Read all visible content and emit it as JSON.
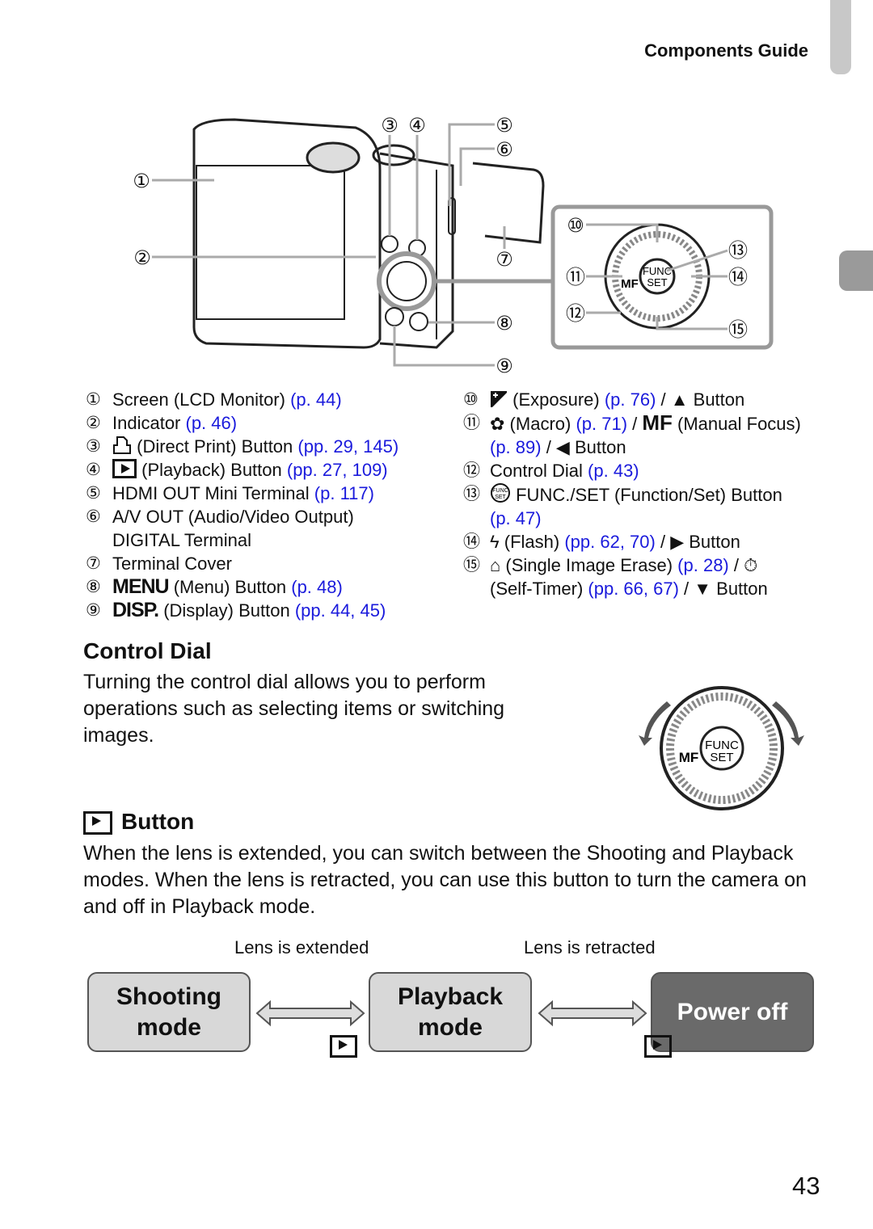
{
  "header": {
    "title": "Components Guide"
  },
  "diagram": {
    "callouts": [
      "①",
      "②",
      "③",
      "④",
      "⑤",
      "⑥",
      "⑦",
      "⑧",
      "⑨",
      "⑩",
      "⑪",
      "⑫",
      "⑬",
      "⑭",
      "⑮"
    ],
    "dial_labels": {
      "func": "FUNC",
      "set": "SET",
      "mf": "MF"
    }
  },
  "components_left": [
    {
      "num": "①",
      "text": "Screen (LCD Monitor) ",
      "ref": "(p. 44)"
    },
    {
      "num": "②",
      "text": "Indicator ",
      "ref": "(p. 46)"
    },
    {
      "num": "③",
      "icon": "print-icon",
      "text": " (Direct Print) Button ",
      "ref": "(pp. 29, 145)"
    },
    {
      "num": "④",
      "icon": "playback-icon",
      "text": " (Playback) Button ",
      "ref": "(pp. 27, 109)"
    },
    {
      "num": "⑤",
      "text": "HDMI OUT Mini Terminal ",
      "ref": "(p. 117)"
    },
    {
      "num": "⑥",
      "text": "A/V OUT (Audio/Video Output)",
      "cont": "DIGITAL Terminal"
    },
    {
      "num": "⑦",
      "text": "Terminal Cover"
    },
    {
      "num": "⑧",
      "iconText": "MENU",
      "text": " (Menu) Button ",
      "ref": "(p. 48)"
    },
    {
      "num": "⑨",
      "iconText": "DISP.",
      "text": " (Display) Button ",
      "ref": "(pp. 44, 45)"
    }
  ],
  "components_right": [
    {
      "num": "⑩",
      "text": " (Exposure) ",
      "ref": "(p. 76)",
      "after": " / ▲ Button"
    },
    {
      "num": "⑪",
      "text": " (Macro) ",
      "ref": "(p. 71)",
      "mid": " / ",
      "mf": "MF",
      "after": " (Manual Focus)",
      "ref2": "(p. 89)",
      "after2": " / ◀ Button"
    },
    {
      "num": "⑫",
      "text": "Control Dial ",
      "ref": "(p. 43)"
    },
    {
      "num": "⑬",
      "text": " FUNC./SET (Function/Set) Button",
      "ref2": "(p. 47)"
    },
    {
      "num": "⑭",
      "text": " (Flash) ",
      "ref": "(pp. 62, 70)",
      "after": " / ▶ Button"
    },
    {
      "num": "⑮",
      "text": " (Single Image Erase) ",
      "ref": "(p. 28)",
      "after": " / ",
      "text2": "(Self-Timer) ",
      "ref2": "(pp. 66, 67)",
      "after2": " / ▼ Button"
    }
  ],
  "control_dial": {
    "title": "Control Dial",
    "body": "Turning the control dial allows you to perform operations such as selecting items or switching images."
  },
  "button_section": {
    "title": "Button",
    "body": "When the lens is extended, you can switch between the Shooting and Playback modes. When the lens is retracted, you can use this button to turn the camera on and off in Playback mode."
  },
  "flow": {
    "label_extended": "Lens is extended",
    "label_retracted": "Lens is retracted",
    "shooting": "Shooting mode",
    "playback": "Playback mode",
    "power_off": "Power off"
  },
  "page_number": "43",
  "colors": {
    "link": "#1a1adc",
    "tab": "#c8c8c8",
    "power_off_box": "#6a6a6a",
    "mode_box": "#d8d8d8"
  }
}
